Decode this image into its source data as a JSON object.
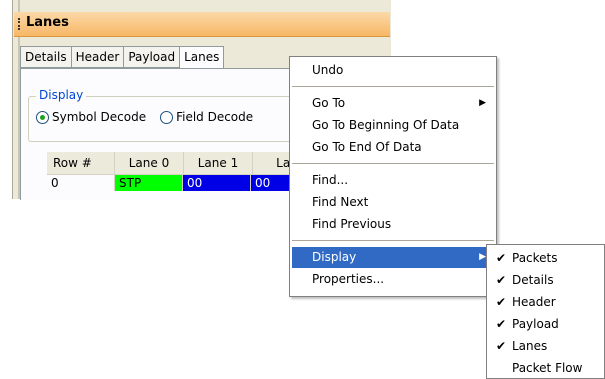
{
  "panel": {
    "title": "Lanes",
    "tabs": [
      "Details",
      "Header",
      "Payload",
      "Lanes"
    ],
    "display_group": {
      "legend": "Display",
      "options": [
        {
          "label": "Symbol Decode",
          "selected": true
        },
        {
          "label": "Field Decode",
          "selected": false
        }
      ]
    },
    "grid": {
      "columns": [
        "Row #",
        "Lane 0",
        "Lane 1",
        "Lan"
      ],
      "rows": [
        [
          "0",
          "STP",
          "00",
          "00"
        ]
      ]
    }
  },
  "context_menu": {
    "groups": [
      [
        {
          "label": "Undo"
        }
      ],
      [
        {
          "label": "Go To",
          "has_submenu": true
        },
        {
          "label": "Go To Beginning Of Data"
        },
        {
          "label": "Go To End Of Data"
        }
      ],
      [
        {
          "label": "Find..."
        },
        {
          "label": "Find Next"
        },
        {
          "label": "Find Previous"
        }
      ],
      [
        {
          "label": "Display",
          "has_submenu": true,
          "highlighted": true
        },
        {
          "label": "Properties..."
        }
      ]
    ]
  },
  "display_submenu": {
    "items": [
      {
        "label": "Packets",
        "checked": true
      },
      {
        "label": "Details",
        "checked": true
      },
      {
        "label": "Header",
        "checked": true
      },
      {
        "label": "Payload",
        "checked": true
      },
      {
        "label": "Lanes",
        "checked": true
      },
      {
        "label": "Packet Flow",
        "checked": false
      }
    ]
  },
  "colors": {
    "highlight": "#316ac5",
    "stp_cell": "#00ff00",
    "lane_cell": "#0000e6",
    "title_bar": "#f7b766"
  }
}
